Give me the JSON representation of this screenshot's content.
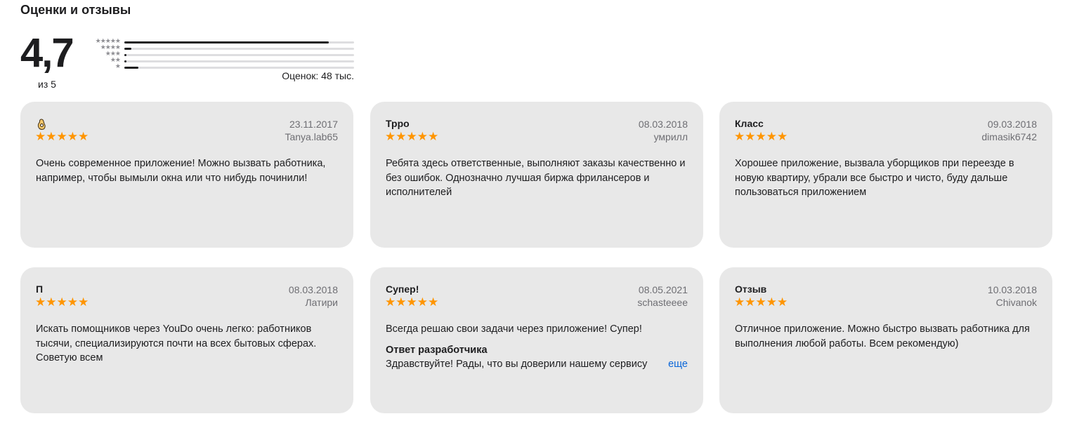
{
  "header": {
    "title": "Оценки и отзывы"
  },
  "summary": {
    "score": "4,7",
    "out_of": "из 5",
    "total": "Оценок: 48 тыс.",
    "histogram": [
      {
        "stars": "★★★★★",
        "fraction": 0.89
      },
      {
        "stars": "★★★★",
        "fraction": 0.03
      },
      {
        "stars": "★★★",
        "fraction": 0.01
      },
      {
        "stars": "★★",
        "fraction": 0.01
      },
      {
        "stars": "★",
        "fraction": 0.06
      }
    ]
  },
  "reviews": [
    {
      "title": "",
      "title_icon": "ok-hand-emoji-icon",
      "date": "23.11.2017",
      "author": "Tanya.lab65",
      "stars": "★★★★★",
      "text": "Очень современное приложение! Можно вызвать работника, например, чтобы вымыли окна или что нибудь починили!"
    },
    {
      "title": "Трро",
      "date": "08.03.2018",
      "author": "умрилл",
      "stars": "★★★★★",
      "text": "Ребята здесь ответственные, выполняют заказы качественно и без ошибок. Однозначно лучшая биржа фрилансеров и исполнителей"
    },
    {
      "title": "Класс",
      "date": "09.03.2018",
      "author": "dimasik6742",
      "stars": "★★★★★",
      "text": "Хорошее приложение, вызвала уборщиков при переезде в новую квартиру, убрали все быстро и чисто, буду дальше пользоваться приложением"
    },
    {
      "title": "П",
      "date": "08.03.2018",
      "author": "Латири",
      "stars": "★★★★★",
      "text": "Искать помощников через YouDo очень легко: работников тысячи, специализируются почти на всех бытовых сферах. Советую всем"
    },
    {
      "title": "Супер!",
      "date": "08.05.2021",
      "author": "schasteeee",
      "stars": "★★★★★",
      "text": "Всегда решаю свои задачи через приложение! Супер!",
      "developer_response_title": "Ответ разработчика",
      "developer_response_text": "Здравствуйте! Рады, что вы доверили нашему сервису",
      "more_label": "еще"
    },
    {
      "title": "Отзыв",
      "date": "10.03.2018",
      "author": "Chivanok",
      "stars": "★★★★★",
      "text": "Отличное приложение. Можно быстро вызвать работника для выполнения любой работы. Всем рекомендую)"
    }
  ],
  "colors": {
    "card_background": "#e8e8e8",
    "star_color": "#ff9500",
    "link_color": "#0a66d8"
  }
}
